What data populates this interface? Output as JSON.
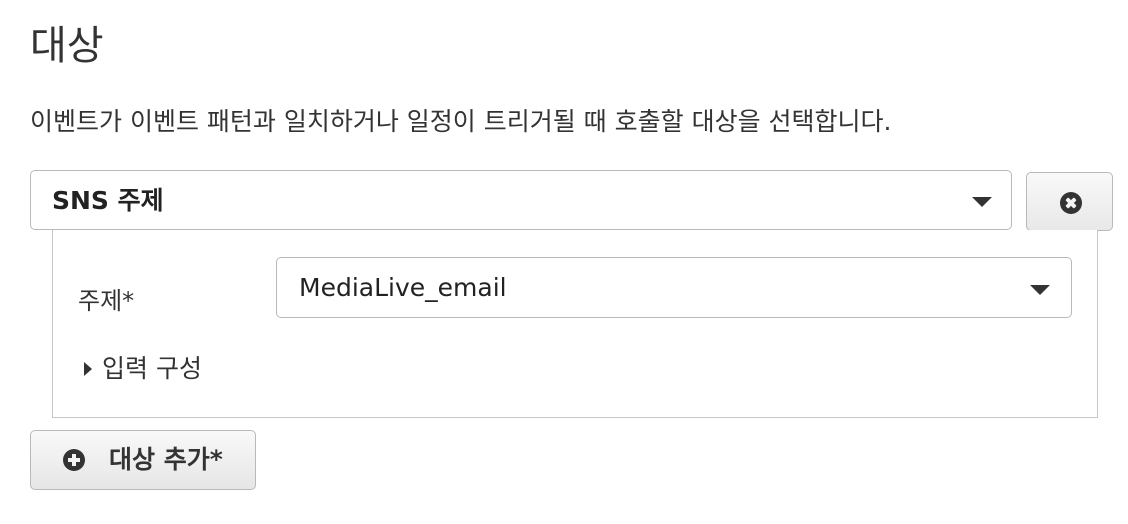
{
  "section": {
    "title": "대상",
    "description": "이벤트가 이벤트 패턴과 일치하거나 일정이 트리거될 때 호출할 대상을 선택합니다."
  },
  "target": {
    "type_value": "SNS 주제",
    "remove_icon": "close-circle-icon",
    "topic_label": "주제*",
    "topic_value": "MediaLive_email",
    "input_config_label": "입력 구성",
    "input_config_expanded": false
  },
  "add_target": {
    "label": "대상 추가*",
    "icon": "plus-circle-icon"
  }
}
